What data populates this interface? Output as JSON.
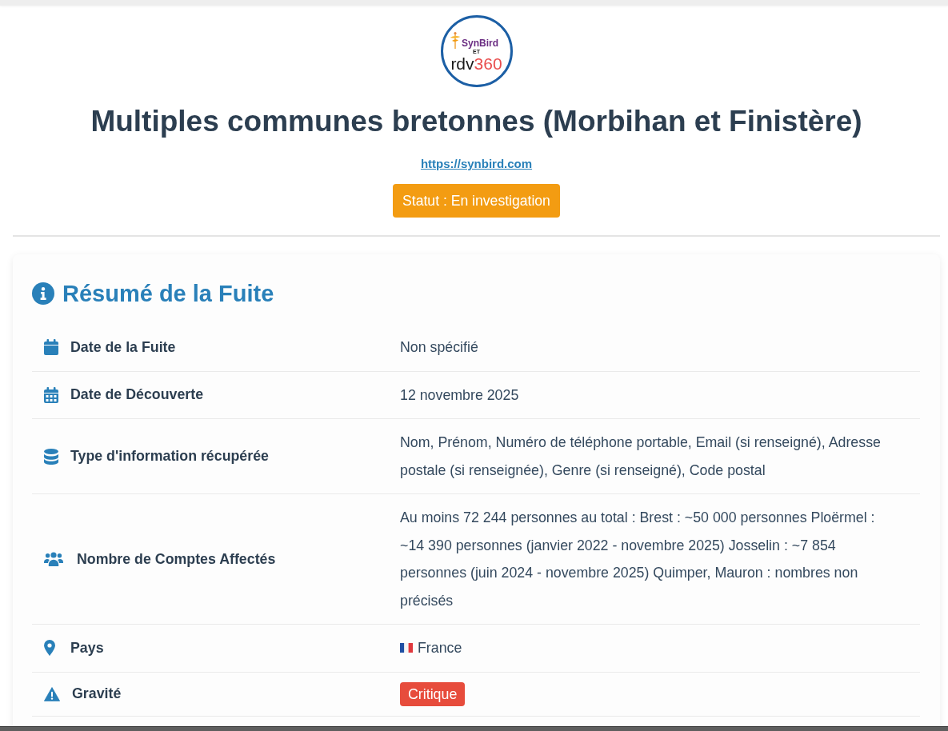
{
  "logo": {
    "top_text": "SynBird",
    "joiner": "ET",
    "bottom_text": "rdv",
    "bottom_number": "360"
  },
  "title": "Multiples communes bretonnes (Morbihan et Finistère)",
  "link": "https://synbird.com",
  "status": {
    "label": "Statut : En investigation"
  },
  "summary": {
    "heading": "Résumé de la Fuite",
    "rows": [
      {
        "kind": "text",
        "label": "Date de la Fuite",
        "value": "Non spécifié"
      },
      {
        "kind": "text",
        "label": "Date de Découverte",
        "value": "12 novembre 2025"
      },
      {
        "kind": "text",
        "label": "Type d'information récupérée",
        "value": "Nom, Prénom, Numéro de téléphone portable, Email (si renseigné), Adresse postale (si renseignée), Genre (si renseigné), Code postal"
      },
      {
        "kind": "text",
        "label": "Nombre de Comptes Affectés",
        "value": "Au moins 72 244 personnes au total : Brest : ~50 000 personnes Ploërmel : ~14 390 personnes (janvier 2022 - novembre 2025) Josselin : ~7 854 personnes (juin 2024 - novembre 2025) Quimper, Mauron : nombres non précisés"
      },
      {
        "kind": "country",
        "label": "Pays",
        "value": "France"
      },
      {
        "kind": "badge",
        "label": "Gravité",
        "value": "Critique"
      }
    ]
  }
}
